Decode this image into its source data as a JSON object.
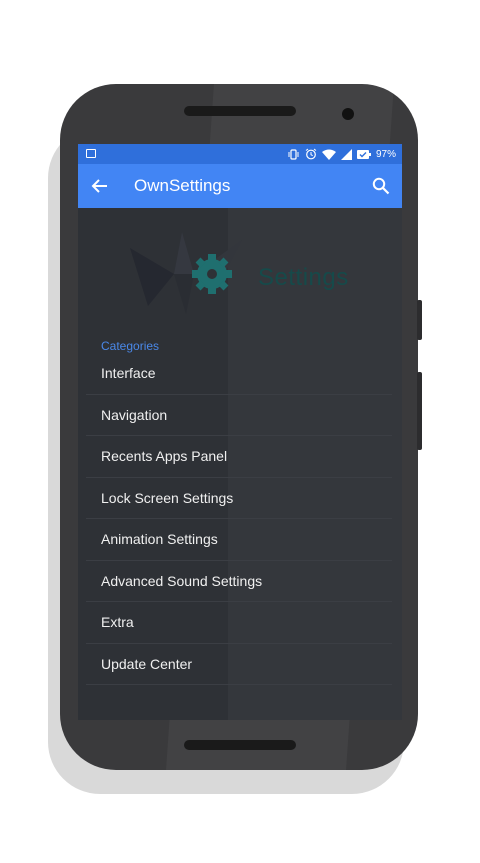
{
  "status_bar": {
    "battery_percent": "97%",
    "icons": [
      "image-notification-icon",
      "vibrate-icon",
      "alarm-icon",
      "wifi-icon",
      "signal-icon",
      "battery-icon"
    ]
  },
  "toolbar": {
    "title": "OwnSettings",
    "back_icon": "arrow-left-icon",
    "search_icon": "search-icon"
  },
  "header": {
    "logo_text": "Settings"
  },
  "section": {
    "label": "Categories"
  },
  "menu": {
    "items": [
      {
        "label": "Interface"
      },
      {
        "label": "Navigation"
      },
      {
        "label": "Recents Apps Panel"
      },
      {
        "label": "Lock Screen Settings"
      },
      {
        "label": "Animation Settings"
      },
      {
        "label": "Advanced Sound Settings"
      },
      {
        "label": "Extra"
      },
      {
        "label": "Update Center"
      }
    ]
  },
  "colors": {
    "status_bar": "#2f6fdb",
    "toolbar": "#4285f4",
    "background": "#2e3136",
    "accent": "#4a88e8",
    "logo_gear": "#1f6f6f"
  }
}
